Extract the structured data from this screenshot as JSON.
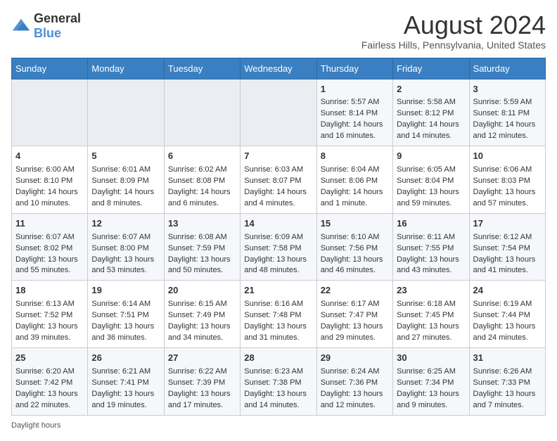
{
  "logo": {
    "general": "General",
    "blue": "Blue"
  },
  "header": {
    "title": "August 2024",
    "subtitle": "Fairless Hills, Pennsylvania, United States"
  },
  "days_of_week": [
    "Sunday",
    "Monday",
    "Tuesday",
    "Wednesday",
    "Thursday",
    "Friday",
    "Saturday"
  ],
  "footer": {
    "daylight_label": "Daylight hours"
  },
  "weeks": [
    {
      "days": [
        {
          "num": "",
          "empty": true
        },
        {
          "num": "",
          "empty": true
        },
        {
          "num": "",
          "empty": true
        },
        {
          "num": "",
          "empty": true
        },
        {
          "num": "1",
          "sunrise": "5:57 AM",
          "sunset": "8:14 PM",
          "daylight": "14 hours and 16 minutes."
        },
        {
          "num": "2",
          "sunrise": "5:58 AM",
          "sunset": "8:12 PM",
          "daylight": "14 hours and 14 minutes."
        },
        {
          "num": "3",
          "sunrise": "5:59 AM",
          "sunset": "8:11 PM",
          "daylight": "14 hours and 12 minutes."
        }
      ]
    },
    {
      "days": [
        {
          "num": "4",
          "sunrise": "6:00 AM",
          "sunset": "8:10 PM",
          "daylight": "14 hours and 10 minutes."
        },
        {
          "num": "5",
          "sunrise": "6:01 AM",
          "sunset": "8:09 PM",
          "daylight": "14 hours and 8 minutes."
        },
        {
          "num": "6",
          "sunrise": "6:02 AM",
          "sunset": "8:08 PM",
          "daylight": "14 hours and 6 minutes."
        },
        {
          "num": "7",
          "sunrise": "6:03 AM",
          "sunset": "8:07 PM",
          "daylight": "14 hours and 4 minutes."
        },
        {
          "num": "8",
          "sunrise": "6:04 AM",
          "sunset": "8:06 PM",
          "daylight": "14 hours and 1 minute."
        },
        {
          "num": "9",
          "sunrise": "6:05 AM",
          "sunset": "8:04 PM",
          "daylight": "13 hours and 59 minutes."
        },
        {
          "num": "10",
          "sunrise": "6:06 AM",
          "sunset": "8:03 PM",
          "daylight": "13 hours and 57 minutes."
        }
      ]
    },
    {
      "days": [
        {
          "num": "11",
          "sunrise": "6:07 AM",
          "sunset": "8:02 PM",
          "daylight": "13 hours and 55 minutes."
        },
        {
          "num": "12",
          "sunrise": "6:07 AM",
          "sunset": "8:00 PM",
          "daylight": "13 hours and 53 minutes."
        },
        {
          "num": "13",
          "sunrise": "6:08 AM",
          "sunset": "7:59 PM",
          "daylight": "13 hours and 50 minutes."
        },
        {
          "num": "14",
          "sunrise": "6:09 AM",
          "sunset": "7:58 PM",
          "daylight": "13 hours and 48 minutes."
        },
        {
          "num": "15",
          "sunrise": "6:10 AM",
          "sunset": "7:56 PM",
          "daylight": "13 hours and 46 minutes."
        },
        {
          "num": "16",
          "sunrise": "6:11 AM",
          "sunset": "7:55 PM",
          "daylight": "13 hours and 43 minutes."
        },
        {
          "num": "17",
          "sunrise": "6:12 AM",
          "sunset": "7:54 PM",
          "daylight": "13 hours and 41 minutes."
        }
      ]
    },
    {
      "days": [
        {
          "num": "18",
          "sunrise": "6:13 AM",
          "sunset": "7:52 PM",
          "daylight": "13 hours and 39 minutes."
        },
        {
          "num": "19",
          "sunrise": "6:14 AM",
          "sunset": "7:51 PM",
          "daylight": "13 hours and 36 minutes."
        },
        {
          "num": "20",
          "sunrise": "6:15 AM",
          "sunset": "7:49 PM",
          "daylight": "13 hours and 34 minutes."
        },
        {
          "num": "21",
          "sunrise": "6:16 AM",
          "sunset": "7:48 PM",
          "daylight": "13 hours and 31 minutes."
        },
        {
          "num": "22",
          "sunrise": "6:17 AM",
          "sunset": "7:47 PM",
          "daylight": "13 hours and 29 minutes."
        },
        {
          "num": "23",
          "sunrise": "6:18 AM",
          "sunset": "7:45 PM",
          "daylight": "13 hours and 27 minutes."
        },
        {
          "num": "24",
          "sunrise": "6:19 AM",
          "sunset": "7:44 PM",
          "daylight": "13 hours and 24 minutes."
        }
      ]
    },
    {
      "days": [
        {
          "num": "25",
          "sunrise": "6:20 AM",
          "sunset": "7:42 PM",
          "daylight": "13 hours and 22 minutes."
        },
        {
          "num": "26",
          "sunrise": "6:21 AM",
          "sunset": "7:41 PM",
          "daylight": "13 hours and 19 minutes."
        },
        {
          "num": "27",
          "sunrise": "6:22 AM",
          "sunset": "7:39 PM",
          "daylight": "13 hours and 17 minutes."
        },
        {
          "num": "28",
          "sunrise": "6:23 AM",
          "sunset": "7:38 PM",
          "daylight": "13 hours and 14 minutes."
        },
        {
          "num": "29",
          "sunrise": "6:24 AM",
          "sunset": "7:36 PM",
          "daylight": "13 hours and 12 minutes."
        },
        {
          "num": "30",
          "sunrise": "6:25 AM",
          "sunset": "7:34 PM",
          "daylight": "13 hours and 9 minutes."
        },
        {
          "num": "31",
          "sunrise": "6:26 AM",
          "sunset": "7:33 PM",
          "daylight": "13 hours and 7 minutes."
        }
      ]
    }
  ]
}
